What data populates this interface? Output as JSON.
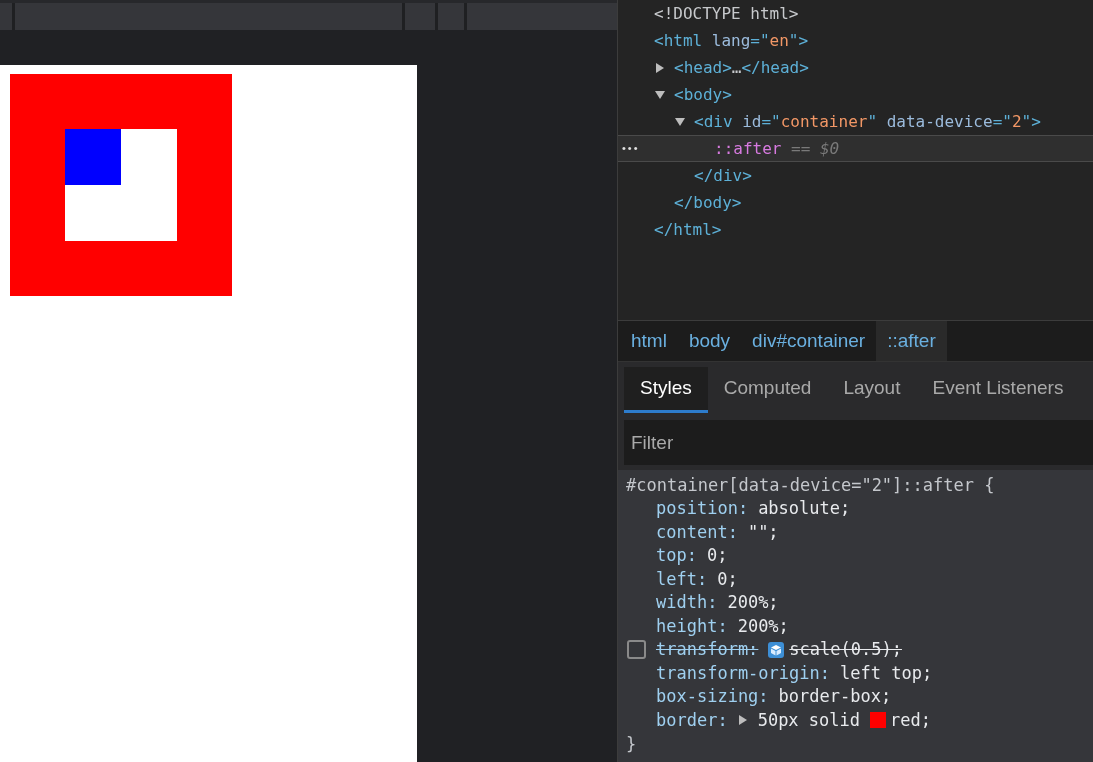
{
  "preview": {
    "kind": "nested-squares"
  },
  "dom_tree": [
    {
      "selected": false,
      "open": [
        {
          "kind": "text",
          "text": "<!DOCTYPE html>"
        }
      ]
    },
    {
      "selected": false,
      "open": [
        {
          "kind": "tag",
          "text": "<html "
        },
        {
          "kind": "attr",
          "text": "lang"
        },
        {
          "kind": "tag",
          "text": "=\""
        },
        {
          "kind": "value",
          "text": "en"
        },
        {
          "kind": "tag",
          "text": "\">"
        }
      ],
      "close": [
        {
          "kind": "tag",
          "text": "</html>"
        }
      ],
      "children": [
        {
          "selected": false,
          "expanded": false,
          "open": [
            {
              "kind": "tag",
              "text": "<head>"
            },
            {
              "kind": "text",
              "text": "…"
            },
            {
              "kind": "tag",
              "text": "</head>"
            }
          ]
        },
        {
          "selected": false,
          "expanded": true,
          "open": [
            {
              "kind": "tag",
              "text": "<body>"
            }
          ],
          "close": [
            {
              "kind": "tag",
              "text": "</body>"
            }
          ],
          "children": [
            {
              "selected": false,
              "expanded": true,
              "open": [
                {
                  "kind": "tag",
                  "text": "<div "
                },
                {
                  "kind": "attr",
                  "text": "id"
                },
                {
                  "kind": "tag",
                  "text": "=\""
                },
                {
                  "kind": "value",
                  "text": "container"
                },
                {
                  "kind": "tag",
                  "text": "\" "
                },
                {
                  "kind": "attr",
                  "text": "data-device"
                },
                {
                  "kind": "tag",
                  "text": "=\""
                },
                {
                  "kind": "value",
                  "text": "2"
                },
                {
                  "kind": "tag",
                  "text": "\">"
                }
              ],
              "close": [
                {
                  "kind": "tag",
                  "text": "</div>"
                }
              ],
              "children": [
                {
                  "selected": true,
                  "menu": "•••",
                  "open": [
                    {
                      "kind": "pseudo",
                      "text": "::after"
                    },
                    {
                      "kind": "hint",
                      "text": " == $0"
                    }
                  ]
                }
              ]
            }
          ]
        }
      ]
    }
  ],
  "breadcrumbs": [
    {
      "label": "html",
      "selected": false
    },
    {
      "label": "body",
      "selected": false
    },
    {
      "label": "div#container",
      "selected": false
    },
    {
      "label": "::after",
      "selected": true
    }
  ],
  "tabs": [
    {
      "label": "Styles",
      "selected": true
    },
    {
      "label": "Computed",
      "selected": false
    },
    {
      "label": "Layout",
      "selected": false
    },
    {
      "label": "Event Listeners",
      "selected": false
    }
  ],
  "filter": {
    "placeholder": "Filter"
  },
  "rule": {
    "selector": "#container[data-device=\"2\"]::after {",
    "close": "}",
    "declarations": [
      {
        "kind": "plain",
        "enabled": true,
        "name": "position:",
        "value": "absolute;"
      },
      {
        "kind": "plain",
        "enabled": true,
        "name": "content:",
        "value": "\"\";"
      },
      {
        "kind": "plain",
        "enabled": true,
        "name": "top:",
        "value": "0;"
      },
      {
        "kind": "plain",
        "enabled": true,
        "name": "left:",
        "value": "0;"
      },
      {
        "kind": "plain",
        "enabled": true,
        "name": "width:",
        "value": "200%;"
      },
      {
        "kind": "plain",
        "enabled": true,
        "name": "height:",
        "value": "200%;"
      },
      {
        "kind": "transform",
        "enabled": false,
        "name": "transform:",
        "value": "scale(0.5);"
      },
      {
        "kind": "plain",
        "enabled": true,
        "name": "transform-origin:",
        "value": "left top;"
      },
      {
        "kind": "plain",
        "enabled": true,
        "name": "box-sizing:",
        "value": "border-box;"
      },
      {
        "kind": "border",
        "enabled": true,
        "name": "border:",
        "value": "50px solid",
        "color": "#ff0000",
        "color_name": "red;"
      }
    ]
  }
}
